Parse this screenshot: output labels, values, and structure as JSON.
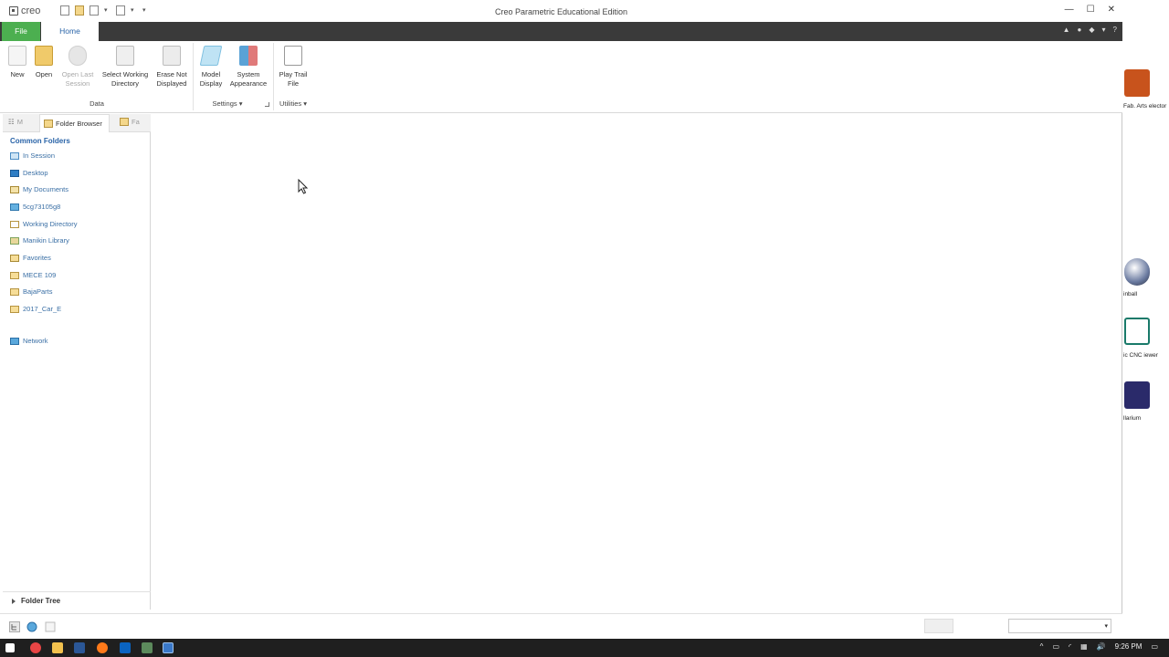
{
  "window": {
    "logo_text": "creo",
    "title": "Creo Parametric Educational Edition"
  },
  "window_controls": {
    "minimize": "—",
    "maximize": "☐",
    "close": "✕"
  },
  "ribbon_tabs": {
    "file": "File",
    "home": "Home"
  },
  "ribbon_right_icons": [
    "▲",
    "●",
    "◆",
    "▾",
    "?"
  ],
  "ribbon": {
    "buttons": {
      "new": "New",
      "open": "Open",
      "open_last_session": "Open Last Session",
      "select_working_directory": "Select Working Directory",
      "erase_not_displayed": "Erase Not Displayed",
      "model_display": "Model Display",
      "system_appearance": "System Appearance",
      "play_trail_file": "Play Trail File"
    },
    "groups": {
      "data": "Data",
      "settings": "Settings ▾",
      "utilities": "Utilities ▾"
    }
  },
  "navigator": {
    "tabs": {
      "model": "M",
      "folder_browser": "Folder Browser",
      "favorites": "Fa"
    },
    "common_folders_title": "Common Folders",
    "folders": [
      {
        "label": "In Session",
        "icon": "session-icon"
      },
      {
        "label": "Desktop",
        "icon": "desktop-icon"
      },
      {
        "label": "My Documents",
        "icon": "documents-icon"
      },
      {
        "label": "5cg73105g8",
        "icon": "computer-icon"
      },
      {
        "label": "Working Directory",
        "icon": "working-directory-icon"
      },
      {
        "label": "Manikin Library",
        "icon": "library-icon"
      },
      {
        "label": "Favorites",
        "icon": "favorites-icon"
      },
      {
        "label": "MECE 109",
        "icon": "folder-icon"
      },
      {
        "label": "BajaParts",
        "icon": "folder-icon"
      },
      {
        "label": "2017_Car_E",
        "icon": "folder-icon"
      }
    ],
    "network": "Network",
    "folder_tree": "Folder Tree"
  },
  "desktop_icons": [
    {
      "label": "Fab. Arts elector"
    },
    {
      "label": "inball"
    },
    {
      "label": "ic CNC iewer"
    },
    {
      "label": "llarium"
    }
  ],
  "taskbar": {
    "clock": "9:26 PM",
    "tray": [
      "^",
      "▭",
      "◜",
      "▦",
      "🔊",
      "▭"
    ]
  }
}
